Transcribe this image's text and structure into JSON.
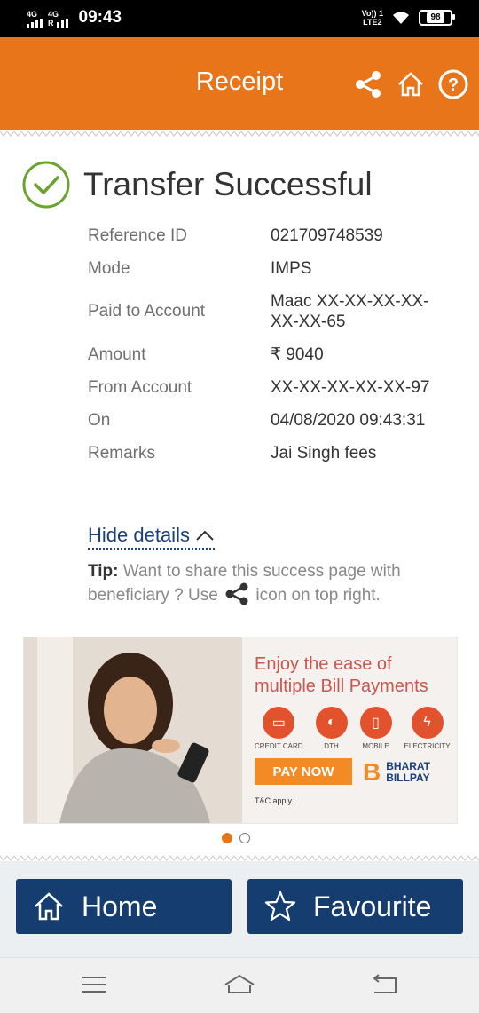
{
  "status_bar": {
    "network_left": "4G",
    "network_right": "4G",
    "roaming_indicator": "R",
    "time": "09:43",
    "volte_top": "Vo)) 1",
    "volte_bottom": "LTE2",
    "battery": "98"
  },
  "header": {
    "title": "Receipt",
    "icons": [
      "share-icon",
      "home-icon",
      "help-icon"
    ],
    "background_color": "#E8751A"
  },
  "transaction": {
    "status_text": "Transfer Successful",
    "status_color": "#6BA32E",
    "details": [
      {
        "label": "Reference ID",
        "value": "021709748539"
      },
      {
        "label": "Mode",
        "value": "IMPS"
      },
      {
        "label": "Paid to Account",
        "value": "Maac XX-XX-XX-XX-XX-XX-65"
      },
      {
        "label": "Amount",
        "value": "₹ 9040"
      },
      {
        "label": "From Account",
        "value": "XX-XX-XX-XX-XX-97"
      },
      {
        "label": "On",
        "value": "04/08/2020 09:43:31"
      },
      {
        "label": "Remarks",
        "value": "Jai Singh fees"
      }
    ],
    "hide_details_label": "Hide details",
    "tip_label": "Tip:",
    "tip_text_before": "Want to share this success page with beneficiary ? Use",
    "tip_text_after": "icon on top right."
  },
  "banner": {
    "headline_line1": "Enjoy the ease of",
    "headline_line2": "multiple Bill Payments",
    "bill_types": [
      {
        "label": "CREDIT CARD",
        "icon": "credit-card-icon"
      },
      {
        "label": "DTH",
        "icon": "satellite-dish-icon"
      },
      {
        "label": "MOBILE",
        "icon": "mobile-icon"
      },
      {
        "label": "ELECTRICITY",
        "icon": "lightning-icon"
      }
    ],
    "cta_label": "PAY NOW",
    "brand_letter": "B",
    "brand_line1": "BHARAT",
    "brand_line2": "BILLPAY",
    "terms": "T&C apply.",
    "carousel_active_index": 0,
    "carousel_count": 2
  },
  "actions": {
    "home_label": "Home",
    "favourite_label": "Favourite",
    "button_color": "#153D70"
  },
  "nav": {
    "icons": [
      "menu-icon",
      "home-nav-icon",
      "back-icon"
    ]
  }
}
